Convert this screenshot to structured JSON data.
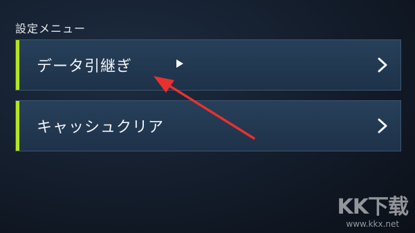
{
  "settings_menu": {
    "title": "設定メニュー",
    "items": [
      {
        "label": "データ引継ぎ"
      },
      {
        "label": "キャッシュクリア"
      }
    ]
  },
  "colors": {
    "accent": "#b5e61d",
    "item_background": "#22384f",
    "annotation_arrow": "#e8312f"
  },
  "icons": {
    "chevron": "chevron-right-icon",
    "cursor": "mouse-pointer-icon"
  },
  "watermark": {
    "logo": "KK下载",
    "url": "www.kkx.net"
  }
}
